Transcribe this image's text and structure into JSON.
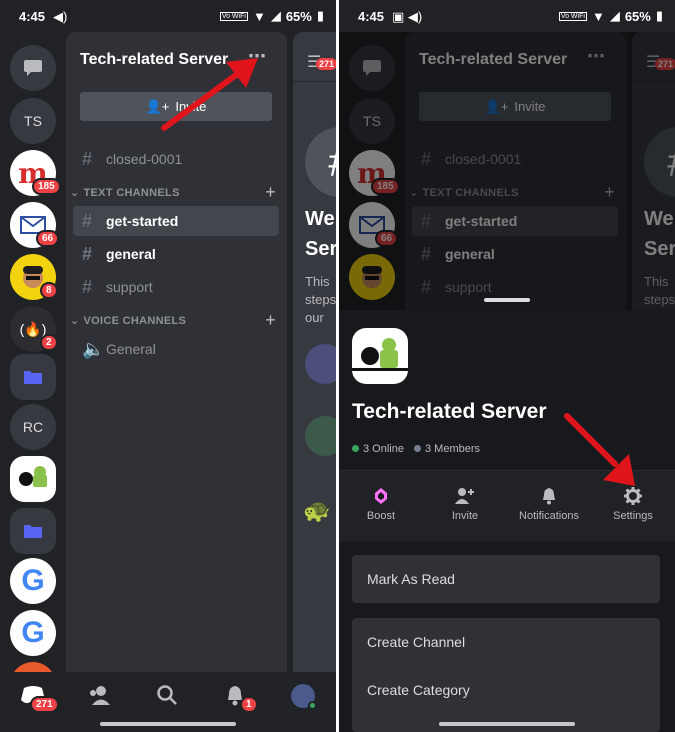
{
  "status": {
    "time": "4:45",
    "battery": "65%",
    "volte": "Vo WiFi"
  },
  "rail": {
    "dm_label": "",
    "servers": [
      {
        "label": "TS"
      },
      {
        "label": "",
        "badge": "185"
      },
      {
        "label": "",
        "badge": "66"
      },
      {
        "label": "",
        "badge": "8"
      },
      {
        "label": "",
        "badge": "2"
      },
      {
        "label": ""
      },
      {
        "label": "RC"
      }
    ]
  },
  "left": {
    "server_name": "Tech-related Server",
    "more_icon": "⋯",
    "invite_label": "Invite",
    "channels": {
      "closed": "closed-0001",
      "text_category": "TEXT CHANNELS",
      "get_started": "get-started",
      "general": "general",
      "support": "support",
      "voice_category": "VOICE CHANNELS",
      "voice_general": "General"
    },
    "peek": {
      "badge": "271",
      "w1": "We",
      "w2": "Ser",
      "t1": "This",
      "t2": "steps",
      "t3": "our"
    },
    "nav": {
      "home_badge": "271",
      "notif_badge": "1"
    }
  },
  "right": {
    "server_name": "Tech-related Server",
    "online": "3 Online",
    "members": "3 Members",
    "actions": {
      "boost": "Boost",
      "invite": "Invite",
      "notifications": "Notifications",
      "settings": "Settings"
    },
    "menu": {
      "mark_read": "Mark As Read",
      "create_channel": "Create Channel",
      "create_category": "Create Category"
    },
    "peek_badge": "271"
  },
  "colors": {
    "accent": "#5865f2",
    "arrow": "#e0151c",
    "badge": "#ed4245",
    "online": "#3ba55d"
  }
}
